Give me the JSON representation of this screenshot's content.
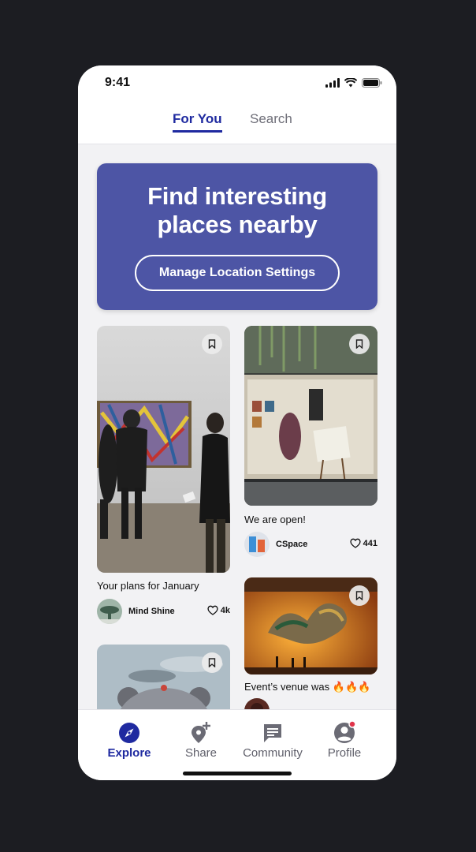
{
  "status_bar": {
    "time": "9:41"
  },
  "top_tabs": [
    {
      "label": "For You",
      "active": true
    },
    {
      "label": "Search",
      "active": false
    }
  ],
  "hero": {
    "title_line1": "Find interesting",
    "title_line2": "places nearby",
    "button_label": "Manage Location Settings",
    "background_color": "#4d55a5"
  },
  "feed": {
    "left": [
      {
        "caption": "Your plans for January",
        "author": "Mind Shine",
        "likes": "4k",
        "image": "gallery-visitors-painting"
      },
      {
        "caption": "",
        "author": "",
        "likes": "",
        "image": "balloon-sculpture-sky"
      }
    ],
    "right": [
      {
        "caption": "We are open!",
        "author": "CSpace",
        "likes": "441",
        "image": "gallery-storefront"
      },
      {
        "caption": "Event’s venue was 🔥🔥🔥",
        "author": "",
        "likes": "",
        "image": "dragon-sculpture-orange-hall"
      }
    ]
  },
  "bottom_nav": [
    {
      "label": "Explore",
      "icon": "compass-icon",
      "active": true
    },
    {
      "label": "Share",
      "icon": "add-location-icon",
      "active": false
    },
    {
      "label": "Community",
      "icon": "chat-icon",
      "active": false
    },
    {
      "label": "Profile",
      "icon": "account-icon",
      "active": false,
      "badge": true
    }
  ],
  "colors": {
    "accent": "#1f2aa0",
    "badge": "#e0344a"
  }
}
